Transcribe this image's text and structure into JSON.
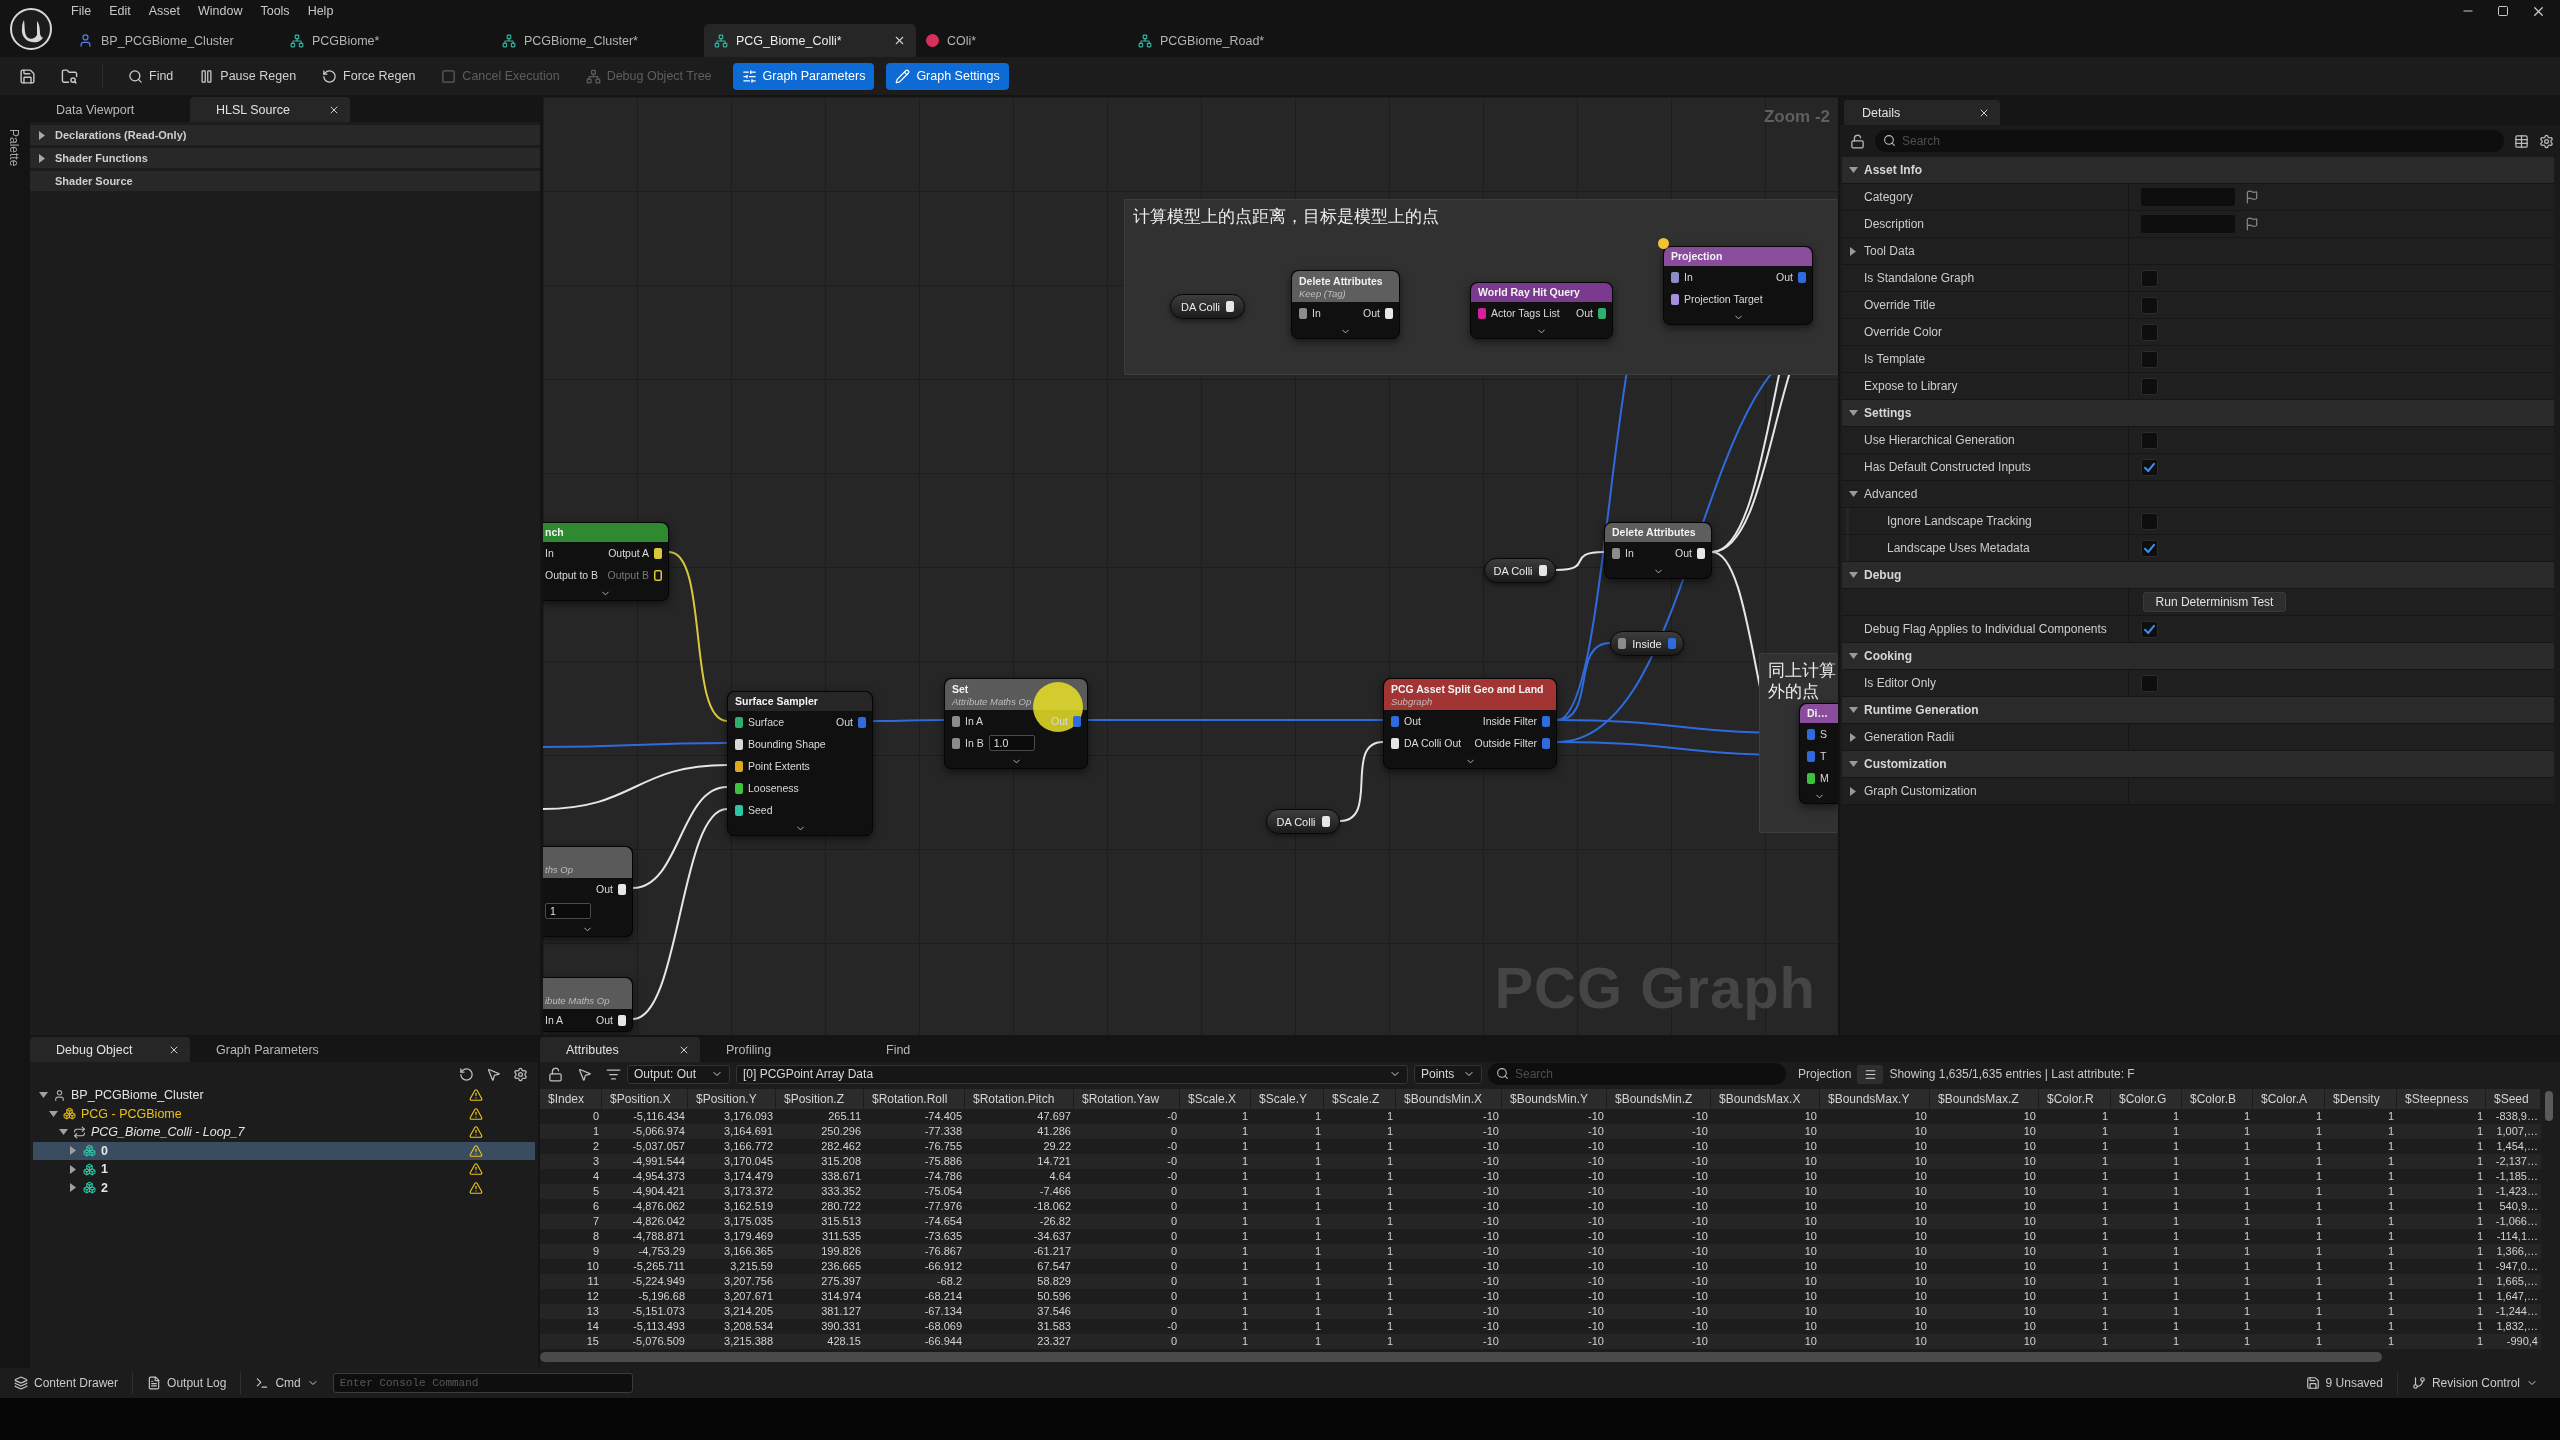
{
  "menu_bar": {
    "items": [
      "File",
      "Edit",
      "Asset",
      "Window",
      "Tools",
      "Help"
    ]
  },
  "document_tabs": [
    {
      "label": "BP_PCGBiome_Cluster",
      "kind": "blueprint",
      "selected": false
    },
    {
      "label": "PCGBiome*",
      "kind": "pcg",
      "selected": false
    },
    {
      "label": "PCGBiome_Cluster*",
      "kind": "pcg",
      "selected": false
    },
    {
      "label": "PCG_Biome_Colli*",
      "kind": "pcg",
      "selected": true
    },
    {
      "label": "COli*",
      "kind": "material",
      "selected": false
    },
    {
      "label": "PCGBiome_Road*",
      "kind": "pcg",
      "selected": false
    }
  ],
  "toolbar": {
    "buttons": [
      {
        "label": "Find",
        "kind": "plain",
        "disabled": false
      },
      {
        "label": "Pause Regen",
        "kind": "plain",
        "disabled": false
      },
      {
        "label": "Force Regen",
        "kind": "plain",
        "disabled": false
      },
      {
        "label": "Cancel Execution",
        "kind": "plain",
        "disabled": true
      },
      {
        "label": "Debug Object Tree",
        "kind": "plain",
        "disabled": true
      },
      {
        "label": "Graph Parameters",
        "kind": "primary",
        "disabled": false
      },
      {
        "label": "Graph Settings",
        "kind": "primary",
        "disabled": false
      }
    ]
  },
  "palette_strip": {
    "label": "Palette"
  },
  "left_panel": {
    "tabs": [
      {
        "label": "Data Viewport",
        "selected": false
      },
      {
        "label": "HLSL Source",
        "selected": true
      }
    ],
    "sections": [
      {
        "label": "Declarations (Read-Only)",
        "collapsible": true
      },
      {
        "label": "Shader Functions",
        "collapsible": true
      },
      {
        "label": "Shader Source",
        "collapsible": false
      }
    ]
  },
  "graph": {
    "zoom_label": "Zoom -2",
    "type_label": "PCG Graph",
    "comments": [
      {
        "title": "计算模型上的点距离，目标是模型上的点"
      },
      {
        "title": "同上计算外的点"
      }
    ],
    "nodes": [
      {
        "kind": "pill",
        "label": "DA Colli",
        "out_pin": {
          "color": "#e6e6e6"
        }
      },
      {
        "kind": "node",
        "title": "Delete Attributes",
        "subtitle": "Keep (Tag)",
        "color": "#5e5e5e",
        "inspected": false,
        "rows": [
          {
            "in": {
              "label": "In",
              "color": "#8c8c8c"
            },
            "out": {
              "label": "Out",
              "color": "#e6e6e6"
            }
          }
        ]
      },
      {
        "kind": "node",
        "title": "World Ray Hit Query",
        "color": "#7a3a8e",
        "inspected": false,
        "rows": [
          {
            "in": {
              "label": "Actor Tags List",
              "color": "#d81e9c"
            },
            "out": {
              "label": "Out",
              "color": "#2fae6e"
            }
          }
        ]
      },
      {
        "kind": "node",
        "title": "Projection",
        "color": "#8a4d9e",
        "inspected": true,
        "rows": [
          {
            "in": {
              "label": "In",
              "color": "#8c8cc8"
            },
            "out": {
              "label": "Out",
              "color": "#2f6bdc"
            }
          },
          {
            "in": {
              "label": "Projection Target",
              "color": "#a58fe0"
            }
          }
        ]
      },
      {
        "kind": "node",
        "title": "nch",
        "color": "#2f8a2f",
        "inspected": false,
        "rows": [
          {
            "in": {
              "label": "In"
            },
            "out": {
              "label": "Output A",
              "color": "#d8c93a",
              "disabled": false
            }
          },
          {
            "in": {
              "label": "Output to B"
            },
            "out": {
              "label": "Output B",
              "color": "#d8c93a",
              "disabled": true
            }
          }
        ]
      },
      {
        "kind": "pill",
        "label": "DA Colli",
        "out_pin": {
          "color": "#e6e6e6"
        }
      },
      {
        "kind": "node",
        "title": "Delete Attributes",
        "color": "#5e5e5e",
        "inspected": false,
        "rows": [
          {
            "in": {
              "label": "In",
              "color": "#8c8c8c"
            },
            "out": {
              "label": "Out",
              "color": "#e6e6e6"
            }
          }
        ]
      },
      {
        "kind": "pill",
        "label": "Inside",
        "in_pin": {
          "color": "#8c8c8c"
        },
        "out_pin": {
          "color": "#2f6bdc"
        }
      },
      {
        "kind": "node",
        "title": "Surface Sampler",
        "color": "#262626",
        "inspected": false,
        "rows": [
          {
            "in": {
              "label": "Surface",
              "color": "#2fae6e"
            },
            "out": {
              "label": "Out",
              "color": "#2f6bdc"
            }
          },
          {
            "in": {
              "label": "Bounding Shape",
              "color": "#d8d8d8"
            }
          },
          {
            "in": {
              "label": "Point Extents",
              "color": "#e0a81e"
            }
          },
          {
            "in": {
              "label": "Looseness",
              "color": "#3cc23c"
            }
          },
          {
            "in": {
              "label": "Seed",
              "color": "#2ec4a4"
            }
          }
        ]
      },
      {
        "kind": "node",
        "title": "Set",
        "subtitle": "Attribute Maths Op",
        "color": "#5a5a5a",
        "inspected": false,
        "rows": [
          {
            "in": {
              "label": "In A",
              "color": "#8c8c8c"
            },
            "out": {
              "label": "Out",
              "color": "#2f6bdc"
            }
          },
          {
            "in": {
              "label": "In B",
              "color": "#8c8c8c",
              "value": "1.0"
            }
          }
        ]
      },
      {
        "kind": "node",
        "title": "PCG Asset Split Geo and Land",
        "subtitle": "Subgraph",
        "color": "#a33434",
        "inspected": false,
        "rows": [
          {
            "in": {
              "label": "Out",
              "color": "#2f6bdc"
            },
            "out": {
              "label": "Inside Filter",
              "color": "#2f6bdc"
            }
          },
          {
            "in": {
              "label": "DA Colli Out",
              "color": "#e6e6e6"
            },
            "out": {
              "label": "Outside Filter",
              "color": "#2f6bdc"
            }
          }
        ]
      },
      {
        "kind": "pill",
        "label": "DA Colli",
        "out_pin": {
          "color": "#e6e6e6"
        }
      },
      {
        "kind": "node",
        "subtitle": "ths Op",
        "color": "#5a5a5a",
        "inspected": false,
        "rows": [
          {
            "out": {
              "label": "Out",
              "color": "#e6e6e6"
            }
          },
          {
            "in": {
              "value": "1"
            }
          }
        ]
      },
      {
        "kind": "node",
        "subtitle": "ibute Maths Op",
        "color": "#5a5a5a",
        "inspected": false,
        "rows": [
          {
            "in": {
              "label": "In A"
            },
            "out": {
              "label": "Out",
              "color": "#e6e6e6"
            }
          }
        ]
      },
      {
        "kind": "node",
        "title": "Di…",
        "color": "#8a4d9e",
        "inspected": false,
        "rows": [
          {
            "in": {
              "label": "S",
              "color": "#2f6bdc"
            }
          },
          {
            "in": {
              "label": "T",
              "color": "#2f6bdc"
            }
          },
          {
            "in": {
              "label": "M",
              "color": "#3cc23c"
            }
          }
        ]
      }
    ]
  },
  "details": {
    "tab": {
      "label": "Details"
    },
    "search": {
      "placeholder": "Search"
    },
    "sections": [
      {
        "title": "Asset Info",
        "expanded": true,
        "rows": [
          {
            "kind": "text",
            "label": "Category"
          },
          {
            "kind": "text",
            "label": "Description"
          },
          {
            "kind": "group",
            "label": "Tool Data",
            "expanded": false
          },
          {
            "kind": "checkbox",
            "label": "Is Standalone Graph",
            "checked": false
          },
          {
            "kind": "checkbox",
            "label": "Override Title",
            "checked": false
          },
          {
            "kind": "checkbox",
            "label": "Override Color",
            "checked": false
          },
          {
            "kind": "checkbox",
            "label": "Is Template",
            "checked": false
          },
          {
            "kind": "checkbox",
            "label": "Expose to Library",
            "checked": false
          }
        ]
      },
      {
        "title": "Settings",
        "expanded": true,
        "rows": [
          {
            "kind": "checkbox",
            "label": "Use Hierarchical Generation",
            "checked": false
          },
          {
            "kind": "checkbox",
            "label": "Has Default Constructed Inputs",
            "checked": true
          },
          {
            "kind": "group",
            "label": "Advanced",
            "expanded": true,
            "children": [
              {
                "kind": "checkbox",
                "label": "Ignore Landscape Tracking",
                "checked": false
              },
              {
                "kind": "checkbox",
                "label": "Landscape Uses Metadata",
                "checked": true
              }
            ]
          }
        ]
      },
      {
        "title": "Debug",
        "expanded": true,
        "rows": [
          {
            "kind": "button",
            "label": "Run Determinism Test"
          },
          {
            "kind": "checkbox",
            "label": "Debug Flag Applies to Individual Components",
            "checked": true
          }
        ]
      },
      {
        "title": "Cooking",
        "expanded": true,
        "rows": [
          {
            "kind": "checkbox",
            "label": "Is Editor Only",
            "checked": false
          }
        ]
      },
      {
        "title": "Runtime Generation",
        "expanded": true,
        "rows": [
          {
            "kind": "group",
            "label": "Generation Radii",
            "expanded": false
          }
        ]
      },
      {
        "title": "Customization",
        "expanded": true,
        "rows": [
          {
            "kind": "group",
            "label": "Graph Customization",
            "expanded": false
          }
        ]
      }
    ]
  },
  "debug_panel": {
    "tabs": [
      {
        "label": "Debug Object",
        "selected": true
      },
      {
        "label": "Graph Parameters",
        "selected": false
      }
    ],
    "tree": [
      {
        "label": "BP_PCGBiome_Cluster",
        "kind": "actor",
        "expanded": true,
        "warning": true,
        "selected": false,
        "children": [
          {
            "label": "PCG - PCGBiome",
            "kind": "component",
            "expanded": true,
            "warning": true,
            "selected": false,
            "children": [
              {
                "label": "PCG_Biome_Colli - Loop_7",
                "kind": "loop",
                "expanded": true,
                "warning": true,
                "selected": false,
                "children": [
                  {
                    "label": "0",
                    "kind": "graph",
                    "expanded": false,
                    "warning": true,
                    "selected": true
                  },
                  {
                    "label": "1",
                    "kind": "graph",
                    "expanded": false,
                    "warning": true,
                    "selected": false
                  },
                  {
                    "label": "2",
                    "kind": "graph",
                    "expanded": false,
                    "warning": true,
                    "selected": false
                  }
                ]
              }
            ]
          }
        ]
      }
    ]
  },
  "attributes_panel": {
    "tabs": [
      {
        "label": "Attributes",
        "selected": true
      },
      {
        "label": "Profiling",
        "selected": false
      },
      {
        "label": "Find",
        "selected": false
      }
    ],
    "output_dropdown": "Output: Out",
    "data_dropdown": "[0] PCGPoint Array Data",
    "domain_dropdown": "Points",
    "search": {
      "placeholder": "Search"
    },
    "node_label": "Projection",
    "summary": "Showing 1,635/1,635 entries | Last attribute: F",
    "table": {
      "columns": [
        "$Index",
        "$Position.X",
        "$Position.Y",
        "$Position.Z",
        "$Rotation.Roll",
        "$Rotation.Pitch",
        "$Rotation.Yaw",
        "$Scale.X",
        "$Scale.Y",
        "$Scale.Z",
        "$BoundsMin.X",
        "$BoundsMin.Y",
        "$BoundsMin.Z",
        "$BoundsMax.X",
        "$BoundsMax.Y",
        "$BoundsMax.Z",
        "$Color.R",
        "$Color.G",
        "$Color.B",
        "$Color.A",
        "$Density",
        "$Steepness",
        "$Seed"
      ],
      "rows": [
        [
          "0",
          "-5,116.434",
          "3,176.093",
          "265.11",
          "-74.405",
          "47.697",
          "-0",
          "1",
          "1",
          "1",
          "-10",
          "-10",
          "-10",
          "10",
          "10",
          "10",
          "1",
          "1",
          "1",
          "1",
          "1",
          "1",
          "-838,9…"
        ],
        [
          "1",
          "-5,066.974",
          "3,164.691",
          "250.296",
          "-77.338",
          "41.286",
          "0",
          "1",
          "1",
          "1",
          "-10",
          "-10",
          "-10",
          "10",
          "10",
          "10",
          "1",
          "1",
          "1",
          "1",
          "1",
          "1",
          "1,007,…"
        ],
        [
          "2",
          "-5,037.057",
          "3,166.772",
          "282.462",
          "-76.755",
          "29.22",
          "-0",
          "1",
          "1",
          "1",
          "-10",
          "-10",
          "-10",
          "10",
          "10",
          "10",
          "1",
          "1",
          "1",
          "1",
          "1",
          "1",
          "1,454,…"
        ],
        [
          "3",
          "-4,991.544",
          "3,170.045",
          "315.208",
          "-75.886",
          "14.721",
          "-0",
          "1",
          "1",
          "1",
          "-10",
          "-10",
          "-10",
          "10",
          "10",
          "10",
          "1",
          "1",
          "1",
          "1",
          "1",
          "1",
          "-2,137…"
        ],
        [
          "4",
          "-4,954.373",
          "3,174.479",
          "338.671",
          "-74.786",
          "4.64",
          "-0",
          "1",
          "1",
          "1",
          "-10",
          "-10",
          "-10",
          "10",
          "10",
          "10",
          "1",
          "1",
          "1",
          "1",
          "1",
          "1",
          "-1,185…"
        ],
        [
          "5",
          "-4,904.421",
          "3,173.372",
          "333.352",
          "-75.054",
          "-7.466",
          "0",
          "1",
          "1",
          "1",
          "-10",
          "-10",
          "-10",
          "10",
          "10",
          "10",
          "1",
          "1",
          "1",
          "1",
          "1",
          "1",
          "-1,423…"
        ],
        [
          "6",
          "-4,876.062",
          "3,162.519",
          "280.722",
          "-77.976",
          "-18.062",
          "0",
          "1",
          "1",
          "1",
          "-10",
          "-10",
          "-10",
          "10",
          "10",
          "10",
          "1",
          "1",
          "1",
          "1",
          "1",
          "1",
          "540,9…"
        ],
        [
          "7",
          "-4,826.042",
          "3,175.035",
          "315.513",
          "-74.654",
          "-26.82",
          "0",
          "1",
          "1",
          "1",
          "-10",
          "-10",
          "-10",
          "10",
          "10",
          "10",
          "1",
          "1",
          "1",
          "1",
          "1",
          "1",
          "-1,066…"
        ],
        [
          "8",
          "-4,788.871",
          "3,179.469",
          "311.535",
          "-73.635",
          "-34.637",
          "0",
          "1",
          "1",
          "1",
          "-10",
          "-10",
          "-10",
          "10",
          "10",
          "10",
          "1",
          "1",
          "1",
          "1",
          "1",
          "1",
          "-114,1…"
        ],
        [
          "9",
          "-4,753.29",
          "3,166.365",
          "199.826",
          "-76.867",
          "-61.217",
          "0",
          "1",
          "1",
          "1",
          "-10",
          "-10",
          "-10",
          "10",
          "10",
          "10",
          "1",
          "1",
          "1",
          "1",
          "1",
          "1",
          "1,366,…"
        ],
        [
          "10",
          "-5,265.711",
          "3,215.59",
          "236.665",
          "-66.912",
          "67.547",
          "0",
          "1",
          "1",
          "1",
          "-10",
          "-10",
          "-10",
          "10",
          "10",
          "10",
          "1",
          "1",
          "1",
          "1",
          "1",
          "1",
          "-947,0…"
        ],
        [
          "11",
          "-5,224.949",
          "3,207.756",
          "275.397",
          "-68.2",
          "58.829",
          "0",
          "1",
          "1",
          "1",
          "-10",
          "-10",
          "-10",
          "10",
          "10",
          "10",
          "1",
          "1",
          "1",
          "1",
          "1",
          "1",
          "1,665,…"
        ],
        [
          "12",
          "-5,196.68",
          "3,207.671",
          "314.974",
          "-68.214",
          "50.596",
          "0",
          "1",
          "1",
          "1",
          "-10",
          "-10",
          "-10",
          "10",
          "10",
          "10",
          "1",
          "1",
          "1",
          "1",
          "1",
          "1",
          "1,647,…"
        ],
        [
          "13",
          "-5,151.073",
          "3,214.205",
          "381.127",
          "-67.134",
          "37.546",
          "0",
          "1",
          "1",
          "1",
          "-10",
          "-10",
          "-10",
          "10",
          "10",
          "10",
          "1",
          "1",
          "1",
          "1",
          "1",
          "1",
          "-1,244…"
        ],
        [
          "14",
          "-5,113.493",
          "3,208.534",
          "390.331",
          "-68.069",
          "31.583",
          "-0",
          "1",
          "1",
          "1",
          "-10",
          "-10",
          "-10",
          "10",
          "10",
          "10",
          "1",
          "1",
          "1",
          "1",
          "1",
          "1",
          "1,832,…"
        ],
        [
          "15",
          "-5,076.509",
          "3,215.388",
          "428.15",
          "-66.944",
          "23.327",
          "0",
          "1",
          "1",
          "1",
          "-10",
          "-10",
          "-10",
          "10",
          "10",
          "10",
          "1",
          "1",
          "1",
          "1",
          "1",
          "1",
          "-990,4"
        ]
      ]
    }
  },
  "status_bar": {
    "left": [
      {
        "label": "Content Drawer",
        "kind": "drawer"
      },
      {
        "label": "Output Log",
        "kind": "log"
      },
      {
        "label": "Cmd",
        "kind": "command"
      }
    ],
    "console": {
      "placeholder": "Enter Console Command"
    },
    "right": [
      {
        "label": "9 Unsaved",
        "kind": "unsaved"
      },
      {
        "label": "Revision Control",
        "kind": "revision"
      }
    ]
  }
}
